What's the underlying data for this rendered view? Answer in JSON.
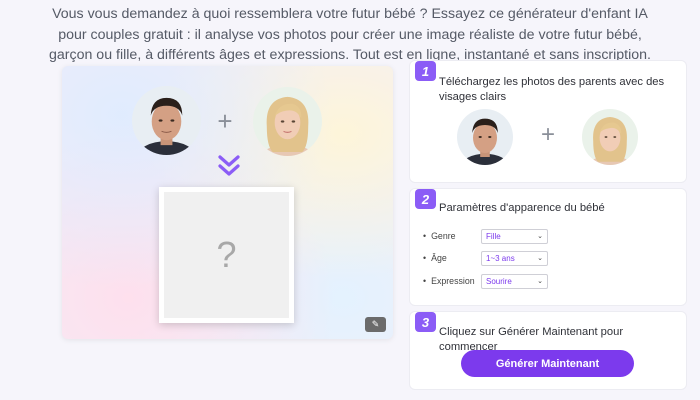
{
  "intro": {
    "line1": "Vous vous demandez à quoi ressemblera votre futur bébé ? Essayez ce générateur d'enfant IA",
    "line2": "pour couples gratuit : il analyse vos photos pour créer une image réaliste de votre futur bébé,",
    "line3": "garçon ou fille, à différents âges et expressions. Tout est en ligne, instantané et sans inscription."
  },
  "preview": {
    "plus": "+",
    "result_placeholder": "?",
    "magic_icon": "✎"
  },
  "steps": [
    {
      "number": "1",
      "title": "Téléchargez les photos des parents avec des visages clairs",
      "plus": "+"
    },
    {
      "number": "2",
      "title": "Paramètres d'apparence du bébé",
      "params": [
        {
          "label": "Genre",
          "value": "Fille"
        },
        {
          "label": "Âge",
          "value": "1~3 ans"
        },
        {
          "label": "Expression",
          "value": "Sourire"
        }
      ]
    },
    {
      "number": "3",
      "title": "Cliquez sur Générer Maintenant pour commencer",
      "button": "Générer Maintenant"
    }
  ],
  "colors": {
    "accent": "#7c3aed",
    "step_badge": "#8b5cf6"
  }
}
